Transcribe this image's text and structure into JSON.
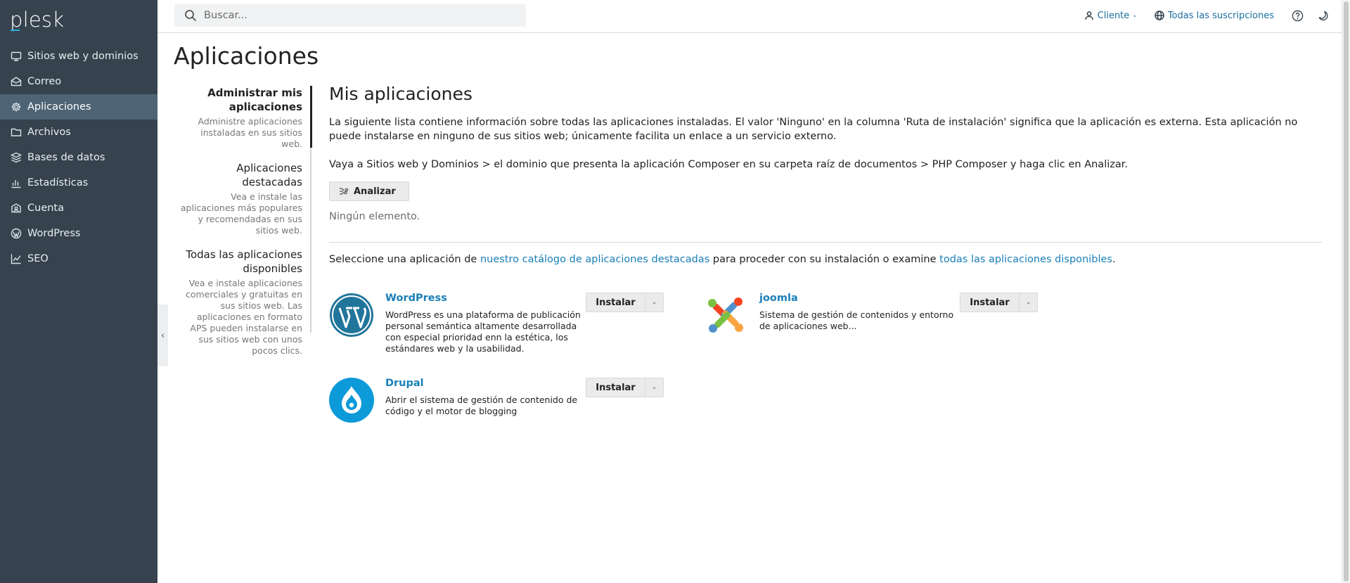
{
  "sidebar": {
    "logo": "plesk",
    "items": [
      {
        "label": "Sitios web y dominios",
        "icon": "monitor-icon"
      },
      {
        "label": "Correo",
        "icon": "mail-icon"
      },
      {
        "label": "Aplicaciones",
        "icon": "gear-icon",
        "active": true
      },
      {
        "label": "Archivos",
        "icon": "folder-icon"
      },
      {
        "label": "Bases de datos",
        "icon": "database-icon"
      },
      {
        "label": "Estadísticas",
        "icon": "bar-chart-icon"
      },
      {
        "label": "Cuenta",
        "icon": "account-icon"
      },
      {
        "label": "WordPress",
        "icon": "wordpress-icon"
      },
      {
        "label": "SEO",
        "icon": "seo-chart-icon"
      }
    ]
  },
  "header": {
    "search_placeholder": "Buscar...",
    "user_label": "Cliente",
    "subscriptions_label": "Todas las suscripciones"
  },
  "page": {
    "title": "Aplicaciones"
  },
  "subnav": [
    {
      "title": "Administrar mis aplicaciones",
      "desc": "Administre aplicaciones instaladas en sus sitios web."
    },
    {
      "title": "Aplicaciones destacadas",
      "desc": "Vea e instale las aplicaciones más populares y recomendadas en sus sitios web."
    },
    {
      "title": "Todas las aplicaciones disponibles",
      "desc": "Vea e instale aplicaciones comerciales y gratuitas en sus sitios web. Las aplicaciones en formato APS pueden instalarse en sus sitios web con unos pocos clics."
    }
  ],
  "main": {
    "section_title": "Mis aplicaciones",
    "paragraph1": "La siguiente lista contiene información sobre todas las aplicaciones instaladas. El valor 'Ninguno' en la columna 'Ruta de instalación' significa que la aplicación es externa. Esta aplicación no puede instalarse en ninguno de sus sitios web; únicamente facilita un enlace a un servicio externo.",
    "paragraph2": "Vaya a Sitios web y Dominios > el dominio que presenta la aplicación Composer en su carpeta raíz de documentos > PHP Composer y haga clic en Analizar.",
    "analyze_label": "Analizar",
    "empty_label": "Ningún elemento.",
    "catalog_prefix": "Seleccione una aplicación de ",
    "catalog_link1": "nuestro catálogo de aplicaciones destacadas",
    "catalog_middle": " para proceder con su instalación o examine ",
    "catalog_link2": "todas las aplicaciones disponibles",
    "catalog_suffix": "."
  },
  "apps": [
    {
      "name": "WordPress",
      "desc": "WordPress es una plataforma de publicación personal semántica altamente desarrollada con especial prioridad enn la estética, los estándares web y la usabilidad.",
      "install_label": "Instalar",
      "color": "#21759b"
    },
    {
      "name": "joomla",
      "desc": "Sistema de gestión de contenidos y entorno de aplicaciones web...",
      "install_label": "Instalar"
    },
    {
      "name": "Drupal",
      "desc": "Abrir el sistema de gestión de contenido de código y el motor de blogging",
      "install_label": "Instalar",
      "color": "#0c9ad9"
    }
  ]
}
